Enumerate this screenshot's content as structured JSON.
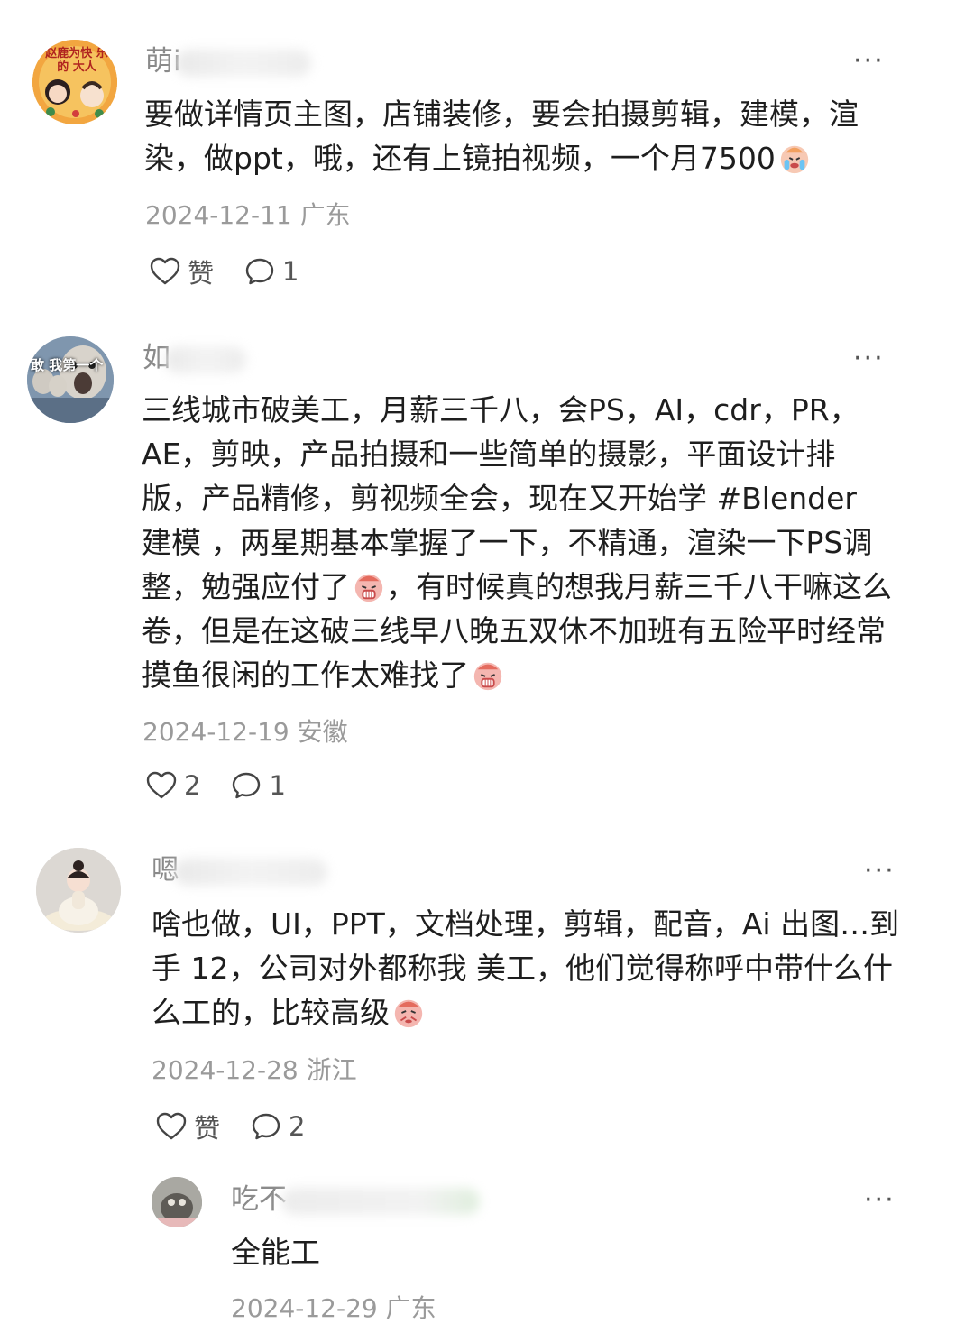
{
  "comments": [
    {
      "username_visible": "萌i",
      "text": "要做详情页主图，店铺装修，要会拍摄剪辑，建模，渲染，做ppt，哦，还有上镜拍视频，一个月7500",
      "date": "2024-12-11",
      "location": "广东",
      "like_label": "赞",
      "reply_count": "1",
      "avatar_text": "赵鹿为快 乐的 大人"
    },
    {
      "username_visible": "如",
      "text": "三线城市破美工，月薪三千八，会PS，AI，cdr，PR，AE，剪映，产品拍摄和一些简单的摄影，平面设计排版，产品精修，剪视频全会，现在又开始学 #Blender 建模 ，两星期基本掌握了一下，不精通，渲染一下PS调整，勉强应付了",
      "text_2": "，有时候真的想我月薪三千八干嘛这么卷，但是在这破三线早八晚五双休不加班有五险平时经常摸鱼很闲的工作太难找了",
      "date": "2024-12-19",
      "location": "安徽",
      "like_count": "2",
      "reply_count": "1",
      "avatar_text": "敢 我第一个"
    },
    {
      "username_visible": "嗯",
      "text": "啥也做，UI，PPT，文档处理，剪辑，配音，Ai 出图…到手 12，公司对外都称我 美工，他们觉得称呼中带什么什么工的，比较高级",
      "date": "2024-12-28",
      "location": "浙江",
      "like_label": "赞",
      "reply_count": "2"
    }
  ],
  "reply": {
    "username_visible": "吃不",
    "text": "全能工",
    "date": "2024-12-29",
    "location": "广东"
  },
  "more_label": "···",
  "colors": {
    "text": "#1e1e1e",
    "meta": "#9a9a9a",
    "username": "#8a8a8a"
  }
}
